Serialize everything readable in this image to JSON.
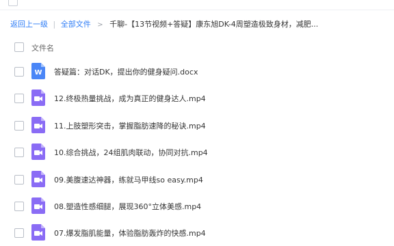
{
  "breadcrumb": {
    "back": "返回上一级",
    "separator": "|",
    "all_files": "全部文件",
    "arrow": ">",
    "current": "千聊-【13节视频+答疑】康东旭DK-4周塑造极致身材，减肥..."
  },
  "header": {
    "column_name": "文件名"
  },
  "files": [
    {
      "name": "答疑篇：对话DK，提出你的健身疑问.docx",
      "icon": "word-doc-icon",
      "icon_label": "W"
    },
    {
      "name": "12.终极热量挑战，成为真正的健身达人.mp4",
      "icon": "video-file-icon"
    },
    {
      "name": "11.上肢塑形突击，掌握脂肪速降的秘诀.mp4",
      "icon": "video-file-icon"
    },
    {
      "name": "10.综合挑战，24组肌肉联动，协同对抗.mp4",
      "icon": "video-file-icon"
    },
    {
      "name": "09.美腹速达神器，练就马甲线so easy.mp4",
      "icon": "video-file-icon"
    },
    {
      "name": "08.塑造性感细腿，展现360°立体美感.mp4",
      "icon": "video-file-icon"
    },
    {
      "name": "07.爆发脂肌能量，体验脂肪轰炸的快感.mp4",
      "icon": "video-file-icon"
    }
  ],
  "colors": {
    "link": "#2f7df6",
    "word_icon": "#4a86f7",
    "video_icon": "#8a6cf5"
  }
}
